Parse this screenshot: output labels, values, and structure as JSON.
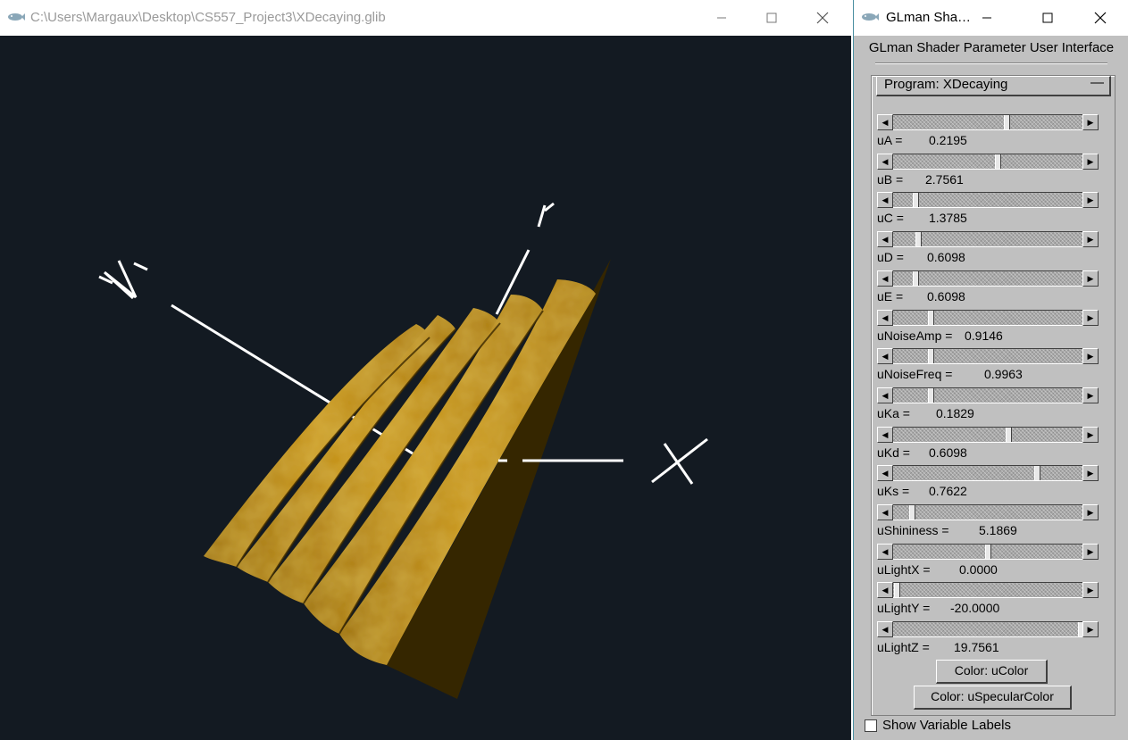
{
  "render_window": {
    "title": "C:\\Users\\Margaux\\Desktop\\CS557_Project3\\XDecaying.glib",
    "axis_labels": {
      "x": "X",
      "y": "Y",
      "z": "Z"
    },
    "colors": {
      "background": "#131a22",
      "surface": "#b8860b",
      "surface_shadow": "#3a2a00",
      "axis": "#ffffff"
    }
  },
  "glman_window": {
    "title": "GLman Sha…",
    "header": "GLman Shader Parameter User Interface",
    "program_label": "Program: XDecaying",
    "program_marker": "—",
    "params": [
      {
        "name": "uA =",
        "value": "0.2195",
        "fraction": 0.6
      },
      {
        "name": "uB =",
        "value": "2.7561",
        "fraction": 0.55
      },
      {
        "name": "uC =",
        "value": "1.3785",
        "fraction": 0.12
      },
      {
        "name": "uD =",
        "value": "0.6098",
        "fraction": 0.13
      },
      {
        "name": "uE =",
        "value": "0.6098",
        "fraction": 0.12
      },
      {
        "name": "uNoiseAmp =",
        "value": "0.9146",
        "fraction": 0.2
      },
      {
        "name": "uNoiseFreq =",
        "value": "0.9963",
        "fraction": 0.2
      },
      {
        "name": "uKa =",
        "value": "0.1829",
        "fraction": 0.2
      },
      {
        "name": "uKd =",
        "value": "0.6098",
        "fraction": 0.61
      },
      {
        "name": "uKs =",
        "value": "0.7622",
        "fraction": 0.76
      },
      {
        "name": "uShininess =",
        "value": "5.1869",
        "fraction": 0.1
      },
      {
        "name": "uLightX =",
        "value": "0.0000",
        "fraction": 0.5
      },
      {
        "name": "uLightY =",
        "value": "-20.0000",
        "fraction": 0.02
      },
      {
        "name": "uLightZ =",
        "value": "19.7561",
        "fraction": 0.99
      }
    ],
    "color_buttons": [
      "Color: uColor",
      "Color: uSpecularColor"
    ],
    "show_labels": "Show Variable Labels"
  }
}
